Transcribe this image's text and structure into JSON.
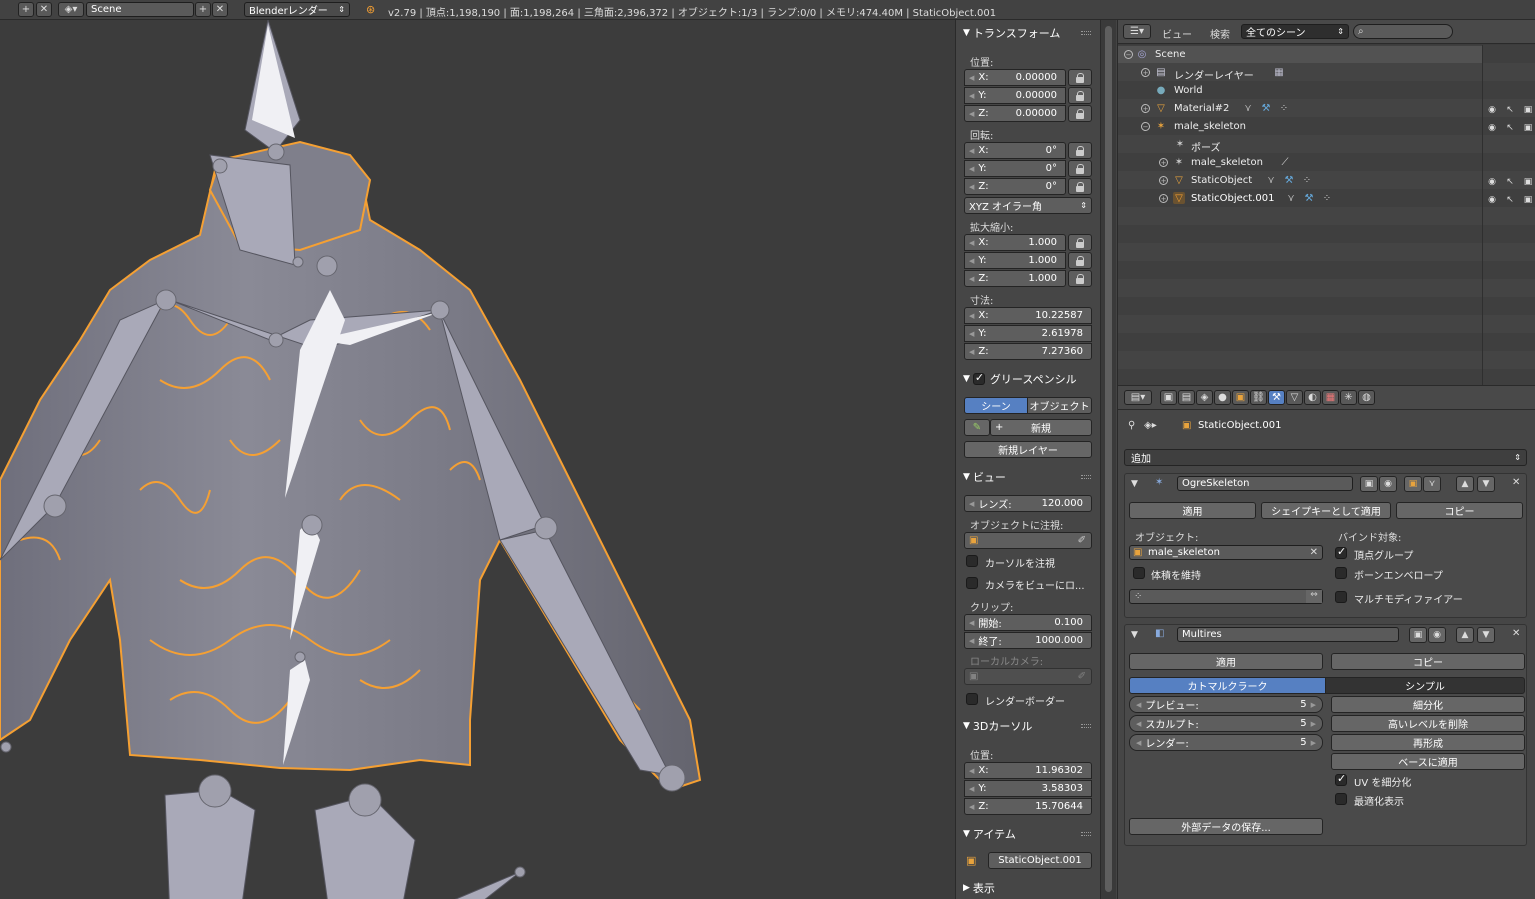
{
  "topbar": {
    "scene_name": "Scene",
    "engine": "Blenderレンダー",
    "stats": "v2.79 | 頂点:1,198,190 | 面:1,198,264 | 三角面:2,396,372 | オブジェクト:1/3 | ランプ:0/0 | メモリ:474.40M | StaticObject.001"
  },
  "npanel": {
    "transform": {
      "title": "トランスフォーム",
      "location_label": "位置:",
      "location": [
        {
          "k": "X:",
          "v": "0.00000"
        },
        {
          "k": "Y:",
          "v": "0.00000"
        },
        {
          "k": "Z:",
          "v": "0.00000"
        }
      ],
      "rotation_label": "回転:",
      "rotation": [
        {
          "k": "X:",
          "v": "0°"
        },
        {
          "k": "Y:",
          "v": "0°"
        },
        {
          "k": "Z:",
          "v": "0°"
        }
      ],
      "rotation_mode": "XYZ オイラー角",
      "scale_label": "拡大縮小:",
      "scale": [
        {
          "k": "X:",
          "v": "1.000"
        },
        {
          "k": "Y:",
          "v": "1.000"
        },
        {
          "k": "Z:",
          "v": "1.000"
        }
      ],
      "dimensions_label": "寸法:",
      "dimensions": [
        {
          "k": "X:",
          "v": "10.22587"
        },
        {
          "k": "Y:",
          "v": "2.61978"
        },
        {
          "k": "Z:",
          "v": "7.27360"
        }
      ]
    },
    "grease": {
      "title": "グリースペンシル",
      "tab_scene": "シーン",
      "tab_object": "オブジェクト",
      "new": "新規",
      "new_layer": "新規レイヤー"
    },
    "view": {
      "title": "ビュー",
      "lens_label": "レンズ:",
      "lens": "120.000",
      "lock_obj": "オブジェクトに注視:",
      "lock_cursor": "カーソルを注視",
      "lock_camera": "カメラをビューにロ...",
      "clip": "クリップ:",
      "clip_start_label": "開始:",
      "clip_start": "0.100",
      "clip_end_label": "終了:",
      "clip_end": "1000.000",
      "local_camera": "ローカルカメラ:",
      "render_border": "レンダーボーダー"
    },
    "cursor": {
      "title": "3Dカーソル",
      "location_label": "位置:",
      "location": [
        {
          "k": "X:",
          "v": "11.96302"
        },
        {
          "k": "Y:",
          "v": "3.58303"
        },
        {
          "k": "Z:",
          "v": "15.70644"
        }
      ]
    },
    "item": {
      "title": "アイテム",
      "name": "StaticObject.001"
    },
    "display": {
      "title": "表示"
    }
  },
  "outliner": {
    "menu_view": "ビュー",
    "menu_search": "検索",
    "display_mode": "全てのシーン",
    "rows": [
      {
        "label": "Scene"
      },
      {
        "label": "レンダーレイヤー"
      },
      {
        "label": "World"
      },
      {
        "label": "Material#2"
      },
      {
        "label": "male_skeleton"
      },
      {
        "label": "ポーズ"
      },
      {
        "label": "male_skeleton"
      },
      {
        "label": "StaticObject"
      },
      {
        "label": "StaticObject.001"
      }
    ]
  },
  "properties": {
    "context_object": "StaticObject.001",
    "add_modifier": "追加",
    "armature": {
      "name": "OgreSkeleton",
      "apply": "適用",
      "apply_shape": "シェイプキーとして適用",
      "copy": "コピー",
      "object_label": "オブジェクト:",
      "object_value": "male_skeleton",
      "preserve_volume": "体積を維持",
      "bind_label": "バインド対象:",
      "vertex_groups": "頂点グループ",
      "bone_envelopes": "ボーンエンベロープ",
      "multi_modifier": "マルチモディファイアー"
    },
    "multires": {
      "name": "Multires",
      "apply": "適用",
      "copy": "コピー",
      "catmull": "カトマルクラーク",
      "simple": "シンプル",
      "preview_label": "プレビュー:",
      "preview": "5",
      "sculpt_label": "スカルプト:",
      "sculpt": "5",
      "render_label": "レンダー:",
      "render": "5",
      "subdivide": "細分化",
      "delete_higher": "高いレベルを削除",
      "reshape": "再形成",
      "apply_base": "ベースに適用",
      "subdivide_uvs": "UV を細分化",
      "optimal_display": "最適化表示",
      "save_external": "外部データの保存..."
    }
  },
  "colors": {
    "accent_blue": "#5680c2",
    "selection_orange": "#f5a033",
    "viewport_bg": "#3c3c3c"
  }
}
